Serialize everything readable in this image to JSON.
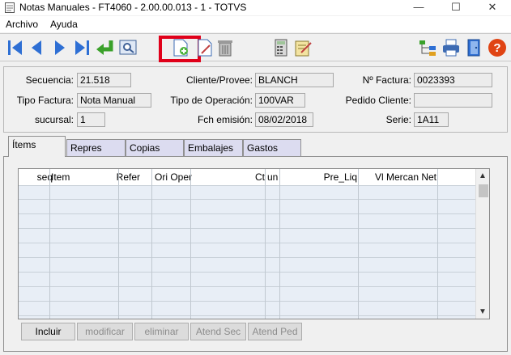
{
  "window": {
    "title": "Notas Manuales - FT4060 - 2.00.00.013 - 1 - TOTVS",
    "minimize": "—",
    "maximize": "☐",
    "close": "✕"
  },
  "menu": [
    "Archivo",
    "Ayuda"
  ],
  "toolbar": {
    "buttons": [
      "first-record-icon",
      "previous-record-icon",
      "next-record-icon",
      "last-record-icon",
      "return-icon",
      "preview-icon",
      "new-document-icon",
      "edit-icon",
      "delete-icon",
      "calculator-icon",
      "notes-icon",
      "tree-icon",
      "print-icon",
      "exit-door-icon",
      "help-icon"
    ],
    "highlight_color": "#e0001a"
  },
  "header": {
    "secuencia_label": "Secuencia:",
    "secuencia_value": "21.518",
    "cliente_label": "Cliente/Provee:",
    "cliente_value": "BLANCH",
    "factura_label": "Nº Factura:",
    "factura_value": "0023393",
    "tipo_factura_label": "Tipo Factura:",
    "tipo_factura_value": "Nota Manual",
    "tipo_operacion_label": "Tipo de Operación:",
    "tipo_operacion_value": "100VAR",
    "pedido_label": "Pedido Cliente:",
    "pedido_value": "",
    "sucursal_label": "sucursal:",
    "sucursal_value": "1",
    "fch_label": "Fch emisión:",
    "fch_value": "08/02/2018",
    "serie_label": "Serie:",
    "serie_value": "1A11"
  },
  "tabs": [
    "Ítems",
    "Repres",
    "Copias",
    "Embalajes",
    "Gastos"
  ],
  "grid": {
    "columns": [
      "seq",
      "Item",
      "Refer",
      "Ori Oper",
      "Ct",
      "un",
      "Pre_Liq",
      "Vl Mercan Net"
    ],
    "rows": []
  },
  "buttons": {
    "incluir": "Incluir",
    "modificar": "modificar",
    "eliminar": "eliminar",
    "atend_sec": "Atend Sec",
    "atend_ped": "Atend Ped"
  }
}
